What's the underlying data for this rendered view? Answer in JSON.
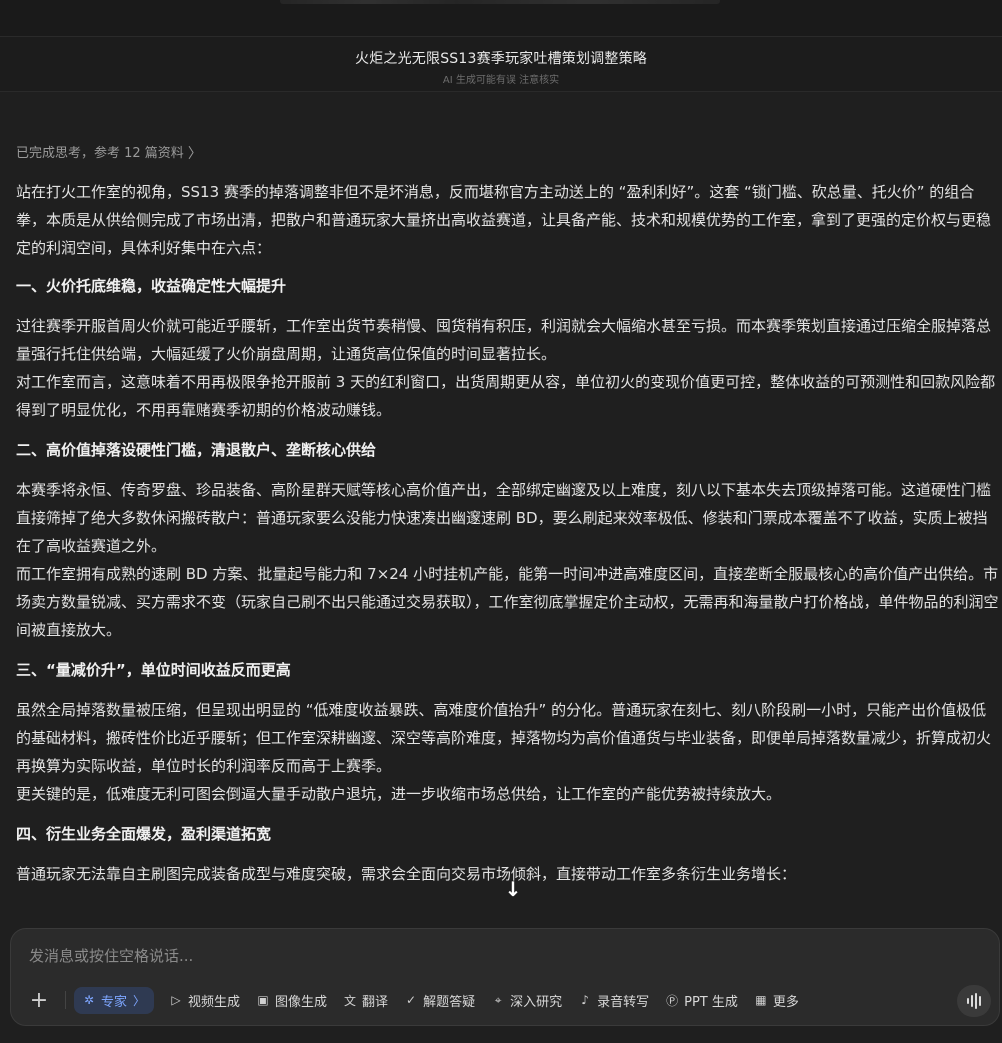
{
  "header": {
    "title": "火炬之光无限SS13赛季玩家吐槽策划调整策略",
    "subtitle": "AI 生成可能有误 注意核实"
  },
  "thinking": {
    "label": "已完成思考，参考 12 篇资料",
    "chevron": "〉"
  },
  "article": {
    "intro": "站在打火工作室的视角，SS13 赛季的掉落调整非但不是坏消息，反而堪称官方主动送上的 “盈利利好”。这套 “锁门槛、砍总量、托火价” 的组合拳，本质是从供给侧完成了市场出清，把散户和普通玩家大量挤出高收益赛道，让具备产能、技术和规模优势的工作室，拿到了更强的定价权与更稳定的利润空间，具体利好集中在六点：",
    "s1_title": "一、火价托底维稳，收益确定性大幅提升",
    "s1_p1": "过往赛季开服首周火价就可能近乎腰斩，工作室出货节奏稍慢、囤货稍有积压，利润就会大幅缩水甚至亏损。而本赛季策划直接通过压缩全服掉落总量强行托住供给端，大幅延缓了火价崩盘周期，让通货高位保值的时间显著拉长。",
    "s1_p2": "对工作室而言，这意味着不用再极限争抢开服前 3 天的红利窗口，出货周期更从容，单位初火的变现价值更可控，整体收益的可预测性和回款风险都得到了明显优化，不用再靠赌赛季初期的价格波动赚钱。",
    "s2_title": "二、高价值掉落设硬性门槛，清退散户、垄断核心供给",
    "s2_p1": "本赛季将永恒、传奇罗盘、珍品装备、高阶星群天赋等核心高价值产出，全部绑定幽邃及以上难度，刻八以下基本失去顶级掉落可能。这道硬性门槛直接筛掉了绝大多数休闲搬砖散户：普通玩家要么没能力快速凑出幽邃速刷 BD，要么刷起来效率极低、修装和门票成本覆盖不了收益，实质上被挡在了高收益赛道之外。",
    "s2_p2": "而工作室拥有成熟的速刷 BD 方案、批量起号能力和 7×24 小时挂机产能，能第一时间冲进高难度区间，直接垄断全服最核心的高价值产出供给。市场卖方数量锐减、买方需求不变（玩家自己刷不出只能通过交易获取），工作室彻底掌握定价主动权，无需再和海量散户打价格战，单件物品的利润空间被直接放大。",
    "s3_title": "三、“量减价升”，单位时间收益反而更高",
    "s3_p1": "虽然全局掉落数量被压缩，但呈现出明显的 “低难度收益暴跌、高难度价值抬升” 的分化。普通玩家在刻七、刻八阶段刷一小时，只能产出价值极低的基础材料，搬砖性价比近乎腰斩；但工作室深耕幽邃、深空等高阶难度，掉落物均为高价值通货与毕业装备，即便单局掉落数量减少，折算成初火再换算为实际收益，单位时长的利润率反而高于上赛季。",
    "s3_p2": "更关键的是，低难度无利可图会倒逼大量手动散户退坑，进一步收缩市场总供给，让工作室的产能优势被持续放大。",
    "s4_title": "四、衍生业务全面爆发，盈利渠道拓宽",
    "s4_p1": "普通玩家无法靠自主刷图完成装备成型与难度突破，需求会全面向交易市场倾斜，直接带动工作室多条衍生业务增长："
  },
  "scroll_down": "↓",
  "composer": {
    "placeholder": "发消息或按住空格说话...",
    "plus": "+",
    "expert_label": "专家",
    "expert_chevron": "〉",
    "tools": [
      "视频生成",
      "图像生成",
      "翻译",
      "解题答疑",
      "深入研究",
      "录音转写",
      "PPT 生成",
      "更多"
    ],
    "tool_icons": [
      "video-icon",
      "image-icon",
      "translate-icon",
      "answer-icon",
      "research-icon",
      "mic-icon",
      "ppt-icon",
      "grid-icon"
    ]
  },
  "colors": {
    "background": "#1f1f1f",
    "expert_accent": "#7ea6ff",
    "expert_bg": "#2f3a52"
  }
}
